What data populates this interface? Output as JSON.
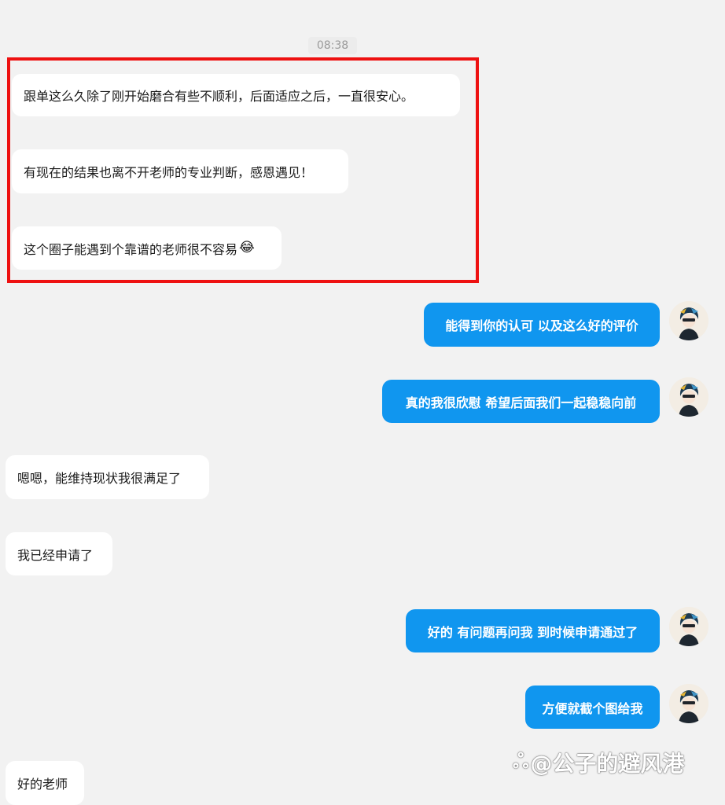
{
  "chat": {
    "timestamp": "08:38",
    "messages": [
      {
        "side": "in",
        "text": "跟单这么久除了刚开始磨合有些不顺利，后面适应之后，一直很安心。"
      },
      {
        "side": "in",
        "text": "有现在的结果也离不开老师的专业判断，感恩遇见！"
      },
      {
        "side": "in",
        "text": "这个圈子能遇到个靠谱的老师很不容易",
        "emoji": "😂"
      },
      {
        "side": "out",
        "text": "能得到你的认可 以及这么好的评价"
      },
      {
        "side": "out",
        "text": "真的我很欣慰 希望后面我们一起稳稳向前"
      },
      {
        "side": "in",
        "text": "嗯嗯，能维持现状我很满足了"
      },
      {
        "side": "in",
        "text": "我已经申请了"
      },
      {
        "side": "out",
        "text": "好的 有问题再问我 到时候申请通过了"
      },
      {
        "side": "out",
        "text": "方便就截个图给我"
      },
      {
        "side": "in",
        "text": "好的老师"
      }
    ]
  },
  "watermark": {
    "logo": "ஃ",
    "text": "@公子的避风港"
  },
  "colors": {
    "background": "#f2f2f2",
    "incoming_bubble": "#ffffff",
    "outgoing_bubble": "#1096ef",
    "highlight_border": "#ee1111"
  }
}
